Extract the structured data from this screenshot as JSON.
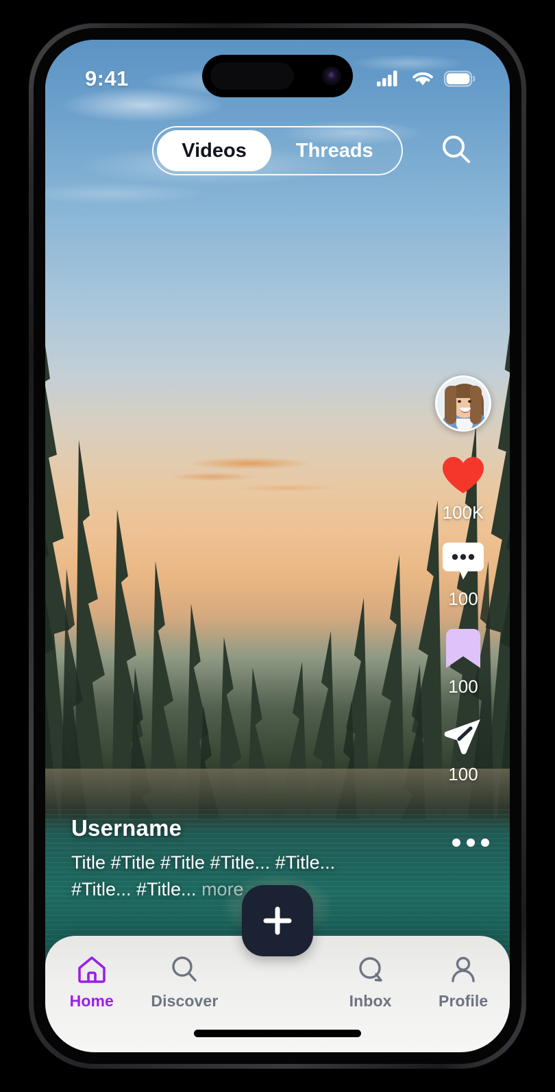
{
  "device": {
    "frame": "iphone-15-pro",
    "status_bar": {
      "time": "9:41",
      "icons": [
        "cellular-signal-icon",
        "wifi-icon",
        "battery-icon"
      ]
    }
  },
  "header": {
    "tabs": [
      {
        "label": "Videos",
        "active": true,
        "name": "tab-videos"
      },
      {
        "label": "Threads",
        "active": false,
        "name": "tab-threads"
      }
    ],
    "search_icon": "search-icon"
  },
  "feed": {
    "post": {
      "username": "Username",
      "caption_line1": "Title #Title #Title #Title... #Title...",
      "caption_line2": "#Title... #Title... ",
      "more_label": "more",
      "more_options_icon": "ellipsis-horizontal-icon"
    },
    "actions": {
      "avatar": {
        "name": "creator-avatar",
        "alt": "Creator profile photo"
      },
      "items": [
        {
          "name": "like-button",
          "icon": "heart-icon",
          "count": "100K",
          "color": "#F5372B"
        },
        {
          "name": "comment-button",
          "icon": "comment-bubble-icon",
          "count": "100",
          "color": "#FFFFFF"
        },
        {
          "name": "bookmark-button",
          "icon": "bookmark-icon",
          "count": "100",
          "color": "#DFC2F7"
        },
        {
          "name": "share-button",
          "icon": "send-paper-plane-icon",
          "count": "100",
          "color": "#FFFFFF"
        }
      ]
    }
  },
  "bottom_nav": {
    "items": [
      {
        "label": "Home",
        "icon": "home-icon",
        "active": true
      },
      {
        "label": "Discover",
        "icon": "search-icon",
        "active": false
      },
      {
        "label": "Inbox",
        "icon": "chat-bubble-icon",
        "active": false
      },
      {
        "label": "Profile",
        "icon": "person-icon",
        "active": false
      }
    ],
    "compose": {
      "icon": "plus-icon",
      "name": "compose-button"
    },
    "active_color": "#9B1FE8",
    "inactive_color": "#6D7480"
  },
  "colors": {
    "accent_purple": "#9B1FE8",
    "like_red": "#F5372B",
    "bookmark_lavender": "#DFC2F7",
    "compose_navy": "#1B2233",
    "nav_background": "#EFEFEE"
  }
}
